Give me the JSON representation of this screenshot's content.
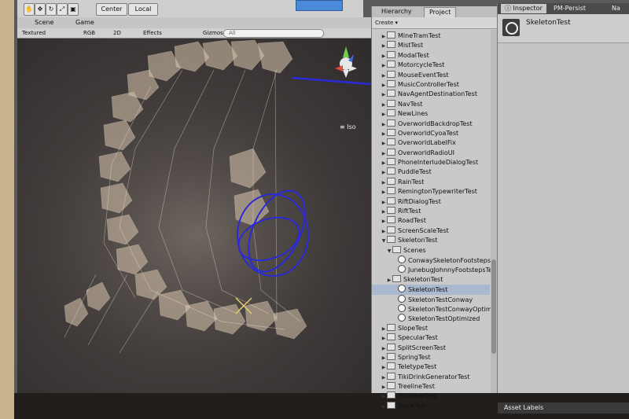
{
  "toolbar": {
    "center_label": "Center",
    "local_label": "Local"
  },
  "scene": {
    "tab_scene": "Scene",
    "tab_game": "Game",
    "shading": "Textured",
    "mode": "RGB",
    "view_2d": "2D",
    "effects": "Effects",
    "gizmos": "Gizmos",
    "search_placeholder": "All",
    "gizmo_iso": "Iso"
  },
  "hierarchy": {
    "tab_hierarchy": "Hierarchy",
    "tab_project": "Project",
    "create_label": "Create",
    "items": [
      {
        "label": "MineTramTest",
        "indent": 1,
        "type": "folder"
      },
      {
        "label": "MistTest",
        "indent": 1,
        "type": "folder"
      },
      {
        "label": "ModalTest",
        "indent": 1,
        "type": "folder"
      },
      {
        "label": "MotorcycleTest",
        "indent": 1,
        "type": "folder"
      },
      {
        "label": "MouseEventTest",
        "indent": 1,
        "type": "folder"
      },
      {
        "label": "MusicControllerTest",
        "indent": 1,
        "type": "folder"
      },
      {
        "label": "NavAgentDestinationTest",
        "indent": 1,
        "type": "folder"
      },
      {
        "label": "NavTest",
        "indent": 1,
        "type": "folder"
      },
      {
        "label": "NewLines",
        "indent": 1,
        "type": "folder"
      },
      {
        "label": "OverworldBackdropTest",
        "indent": 1,
        "type": "folder"
      },
      {
        "label": "OverworldCyoaTest",
        "indent": 1,
        "type": "folder"
      },
      {
        "label": "OverworldLabelFix",
        "indent": 1,
        "type": "folder"
      },
      {
        "label": "OverworldRadioUI",
        "indent": 1,
        "type": "folder"
      },
      {
        "label": "PhoneInterludeDialogTest",
        "indent": 1,
        "type": "folder"
      },
      {
        "label": "PuddleTest",
        "indent": 1,
        "type": "folder"
      },
      {
        "label": "RainTest",
        "indent": 1,
        "type": "folder"
      },
      {
        "label": "RemingtonTypewriterTest",
        "indent": 1,
        "type": "folder"
      },
      {
        "label": "RiftDialogTest",
        "indent": 1,
        "type": "folder"
      },
      {
        "label": "RiftTest",
        "indent": 1,
        "type": "folder"
      },
      {
        "label": "RoadTest",
        "indent": 1,
        "type": "folder"
      },
      {
        "label": "ScreenScaleTest",
        "indent": 1,
        "type": "folder"
      },
      {
        "label": "SkeletonTest",
        "indent": 1,
        "type": "folder-open"
      },
      {
        "label": "Scenes",
        "indent": 2,
        "type": "folder-open"
      },
      {
        "label": "ConwaySkeletonFootstepsTes",
        "indent": 3,
        "type": "scene"
      },
      {
        "label": "JunebugJohnnyFootstepsTest",
        "indent": 3,
        "type": "scene"
      },
      {
        "label": "SkeletonTest",
        "indent": 2,
        "type": "folder"
      },
      {
        "label": "SkeletonTest",
        "indent": 3,
        "type": "scene",
        "selected": true
      },
      {
        "label": "SkeletonTestConway",
        "indent": 3,
        "type": "scene"
      },
      {
        "label": "SkeletonTestConwayOptimize",
        "indent": 3,
        "type": "scene"
      },
      {
        "label": "SkeletonTestOptimized",
        "indent": 3,
        "type": "scene"
      },
      {
        "label": "SlopeTest",
        "indent": 1,
        "type": "folder"
      },
      {
        "label": "SpecularTest",
        "indent": 1,
        "type": "folder"
      },
      {
        "label": "SplitScreenTest",
        "indent": 1,
        "type": "folder"
      },
      {
        "label": "SpringTest",
        "indent": 1,
        "type": "folder"
      },
      {
        "label": "TeletypeTest",
        "indent": 1,
        "type": "folder"
      },
      {
        "label": "TikiDrinkGeneratorTest",
        "indent": 1,
        "type": "folder"
      },
      {
        "label": "TreelineTest",
        "indent": 1,
        "type": "folder"
      },
      {
        "label": "TriplanarTest",
        "indent": 1,
        "type": "folder"
      },
      {
        "label": "TruckTest",
        "indent": 1,
        "type": "folder"
      }
    ]
  },
  "inspector": {
    "tab_inspector": "Inspector",
    "tab_pm": "PM-Persist",
    "tab_nav": "Na",
    "object_name": "SkeletonTest",
    "asset_labels": "Asset Labels"
  },
  "colors": {
    "selection": "#a9b8cf",
    "play_button": "#4b8ad8",
    "gizmo_blue": "#2a2ad6"
  }
}
